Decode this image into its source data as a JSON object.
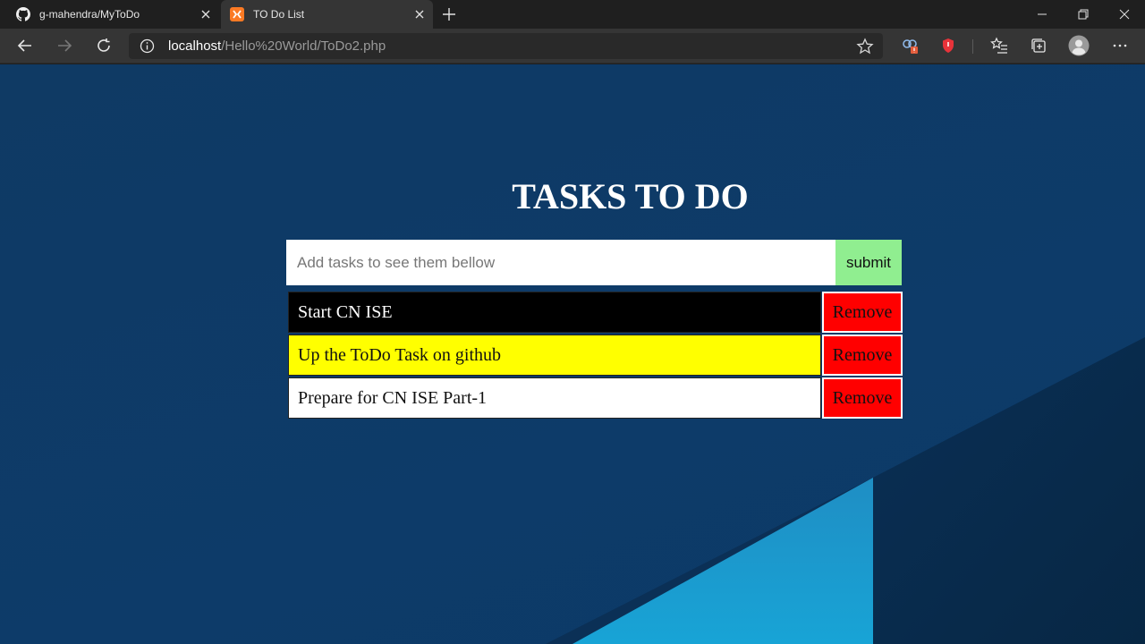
{
  "browser": {
    "tabs": [
      {
        "title": "g-mahendra/MyToDo",
        "icon": "github-icon",
        "active": false
      },
      {
        "title": "TO Do List",
        "icon": "xampp-icon",
        "active": true
      }
    ],
    "address": {
      "host": "localhost",
      "path": "/Hello%20World/ToDo2.php"
    }
  },
  "page": {
    "heading": "TASKS TO DO",
    "input": {
      "placeholder": "Add tasks to see them bellow",
      "value": ""
    },
    "submit_label": "submit",
    "tasks": [
      {
        "text": "Start CN ISE",
        "color": "#000000",
        "text_color": "#ffffff",
        "remove_label": "Remove"
      },
      {
        "text": "Up the ToDo Task on github",
        "color": "#ffff00",
        "text_color": "#111111",
        "remove_label": "Remove"
      },
      {
        "text": "Prepare for CN ISE Part-1",
        "color": "#ffffff",
        "text_color": "#111111",
        "remove_label": "Remove"
      }
    ]
  },
  "colors": {
    "background": "#0d3b69",
    "submit": "#90ee90",
    "remove": "#ff0000"
  }
}
